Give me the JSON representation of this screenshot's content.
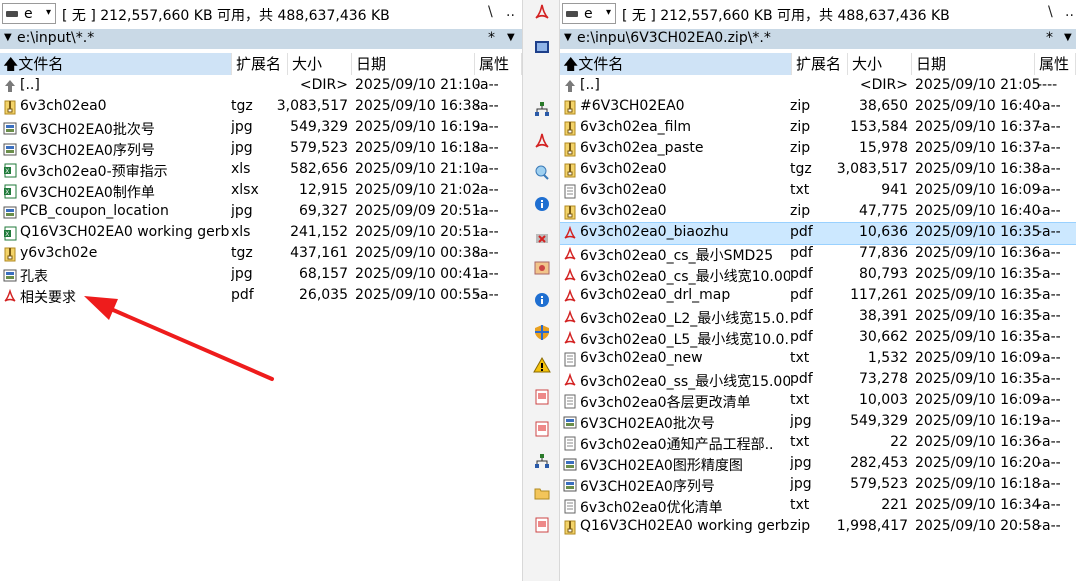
{
  "left": {
    "drive": {
      "letter": "e",
      "info": "[ 无 ]  212,557,660 KB 可用，共 488,637,436 KB",
      "root_btn": "\\",
      "up_btn": ".."
    },
    "path": "e:\\input\\*.*",
    "filter_star": "*",
    "headers": {
      "name": "文件名",
      "ext": "扩展名",
      "size": "大小",
      "date": "日期",
      "attr": "属性"
    },
    "rows": [
      {
        "name": "[..]",
        "ext": "",
        "size": "<DIR>",
        "date": "2025/09/10 21:10",
        "attr": "-a--",
        "icon": "up"
      },
      {
        "name": "6v3ch02ea0",
        "ext": "tgz",
        "size": "3,083,517",
        "date": "2025/09/10 16:38",
        "attr": "-a--",
        "icon": "zip"
      },
      {
        "name": "6V3CH02EA0批次号",
        "ext": "jpg",
        "size": "549,329",
        "date": "2025/09/10 16:19",
        "attr": "-a--",
        "icon": "img"
      },
      {
        "name": "6V3CH02EA0序列号",
        "ext": "jpg",
        "size": "579,523",
        "date": "2025/09/10 16:18",
        "attr": "-a--",
        "icon": "img"
      },
      {
        "name": "6v3ch02ea0-预审指示",
        "ext": "xls",
        "size": "582,656",
        "date": "2025/09/10 21:10",
        "attr": "-a--",
        "icon": "xls"
      },
      {
        "name": "6V3CH02EA0制作单",
        "ext": "xlsx",
        "size": "12,915",
        "date": "2025/09/10 21:02",
        "attr": "-a--",
        "icon": "xls"
      },
      {
        "name": "PCB_coupon_location",
        "ext": "jpg",
        "size": "69,327",
        "date": "2025/09/09 20:51",
        "attr": "-a--",
        "icon": "img"
      },
      {
        "name": "Q16V3CH02EA0 working gerb..",
        "ext": "xls",
        "size": "241,152",
        "date": "2025/09/10 20:51",
        "attr": "-a--",
        "icon": "xls"
      },
      {
        "name": "y6v3ch02e",
        "ext": "tgz",
        "size": "437,161",
        "date": "2025/09/10 00:38",
        "attr": "-a--",
        "icon": "zip"
      },
      {
        "name": "孔表",
        "ext": "jpg",
        "size": "68,157",
        "date": "2025/09/10 00:41",
        "attr": "-a--",
        "icon": "img"
      },
      {
        "name": "相关要求",
        "ext": "pdf",
        "size": "26,035",
        "date": "2025/09/10 00:55",
        "attr": "-a--",
        "icon": "pdf"
      }
    ]
  },
  "right": {
    "drive": {
      "letter": "e",
      "info": "[ 无 ]  212,557,660 KB 可用，共 488,637,436 KB",
      "root_btn": "\\",
      "up_btn": ".."
    },
    "path": "e:\\inpu\\6V3CH02EA0.zip\\*.*",
    "filter_star": "*",
    "headers": {
      "name": "文件名",
      "ext": "扩展名",
      "size": "大小",
      "date": "日期",
      "attr": "属性"
    },
    "rows": [
      {
        "name": "[..]",
        "ext": "",
        "size": "<DIR>",
        "date": "2025/09/10 21:05",
        "attr": "----",
        "icon": "up"
      },
      {
        "name": "#6V3CH02EA0",
        "ext": "zip",
        "size": "38,650",
        "date": "2025/09/10 16:40",
        "attr": "-a--",
        "icon": "zip"
      },
      {
        "name": "6v3ch02ea_film",
        "ext": "zip",
        "size": "153,584",
        "date": "2025/09/10 16:37",
        "attr": "-a--",
        "icon": "zip"
      },
      {
        "name": "6v3ch02ea_paste",
        "ext": "zip",
        "size": "15,978",
        "date": "2025/09/10 16:37",
        "attr": "-a--",
        "icon": "zip"
      },
      {
        "name": "6v3ch02ea0",
        "ext": "tgz",
        "size": "3,083,517",
        "date": "2025/09/10 16:38",
        "attr": "-a--",
        "icon": "zip"
      },
      {
        "name": "6v3ch02ea0",
        "ext": "txt",
        "size": "941",
        "date": "2025/09/10 16:09",
        "attr": "-a--",
        "icon": "txt"
      },
      {
        "name": "6v3ch02ea0",
        "ext": "zip",
        "size": "47,775",
        "date": "2025/09/10 16:40",
        "attr": "-a--",
        "icon": "zip"
      },
      {
        "name": "6v3ch02ea0_biaozhu",
        "ext": "pdf",
        "size": "10,636",
        "date": "2025/09/10 16:35",
        "attr": "-a--",
        "icon": "pdf"
      },
      {
        "name": "6v3ch02ea0_cs_最小SMD25",
        "ext": "pdf",
        "size": "77,836",
        "date": "2025/09/10 16:36",
        "attr": "-a--",
        "icon": "pdf"
      },
      {
        "name": "6v3ch02ea0_cs_最小线宽10.00..",
        "ext": "pdf",
        "size": "80,793",
        "date": "2025/09/10 16:35",
        "attr": "-a--",
        "icon": "pdf"
      },
      {
        "name": "6v3ch02ea0_drl_map",
        "ext": "pdf",
        "size": "117,261",
        "date": "2025/09/10 16:35",
        "attr": "-a--",
        "icon": "pdf"
      },
      {
        "name": "6v3ch02ea0_L2_最小线宽15.0..",
        "ext": "pdf",
        "size": "38,391",
        "date": "2025/09/10 16:35",
        "attr": "-a--",
        "icon": "pdf"
      },
      {
        "name": "6v3ch02ea0_L5_最小线宽10.0..",
        "ext": "pdf",
        "size": "30,662",
        "date": "2025/09/10 16:35",
        "attr": "-a--",
        "icon": "pdf"
      },
      {
        "name": "6v3ch02ea0_new",
        "ext": "txt",
        "size": "1,532",
        "date": "2025/09/10 16:09",
        "attr": "-a--",
        "icon": "txt"
      },
      {
        "name": "6v3ch02ea0_ss_最小线宽15.000",
        "ext": "pdf",
        "size": "73,278",
        "date": "2025/09/10 16:35",
        "attr": "-a--",
        "icon": "pdf"
      },
      {
        "name": "6v3ch02ea0各层更改清单",
        "ext": "txt",
        "size": "10,003",
        "date": "2025/09/10 16:09",
        "attr": "-a--",
        "icon": "txt"
      },
      {
        "name": "6V3CH02EA0批次号",
        "ext": "jpg",
        "size": "549,329",
        "date": "2025/09/10 16:19",
        "attr": "-a--",
        "icon": "img"
      },
      {
        "name": "6v3ch02ea0通知产品工程部..",
        "ext": "txt",
        "size": "22",
        "date": "2025/09/10 16:36",
        "attr": "-a--",
        "icon": "txt"
      },
      {
        "name": "6V3CH02EA0图形精度图",
        "ext": "jpg",
        "size": "282,453",
        "date": "2025/09/10 16:20",
        "attr": "-a--",
        "icon": "img"
      },
      {
        "name": "6V3CH02EA0序列号",
        "ext": "jpg",
        "size": "579,523",
        "date": "2025/09/10 16:18",
        "attr": "-a--",
        "icon": "img"
      },
      {
        "name": "6v3ch02ea0优化清单",
        "ext": "txt",
        "size": "221",
        "date": "2025/09/10 16:34",
        "attr": "-a--",
        "icon": "txt"
      },
      {
        "name": "Q16V3CH02EA0 working gerb..",
        "ext": "zip",
        "size": "1,998,417",
        "date": "2025/09/10 20:58",
        "attr": "-a--",
        "icon": "zip"
      }
    ],
    "selected_row": 7
  },
  "toolbar": {
    "buttons": [
      "pdf-icon",
      "terminal-icon",
      "network-icon",
      "pdf-icon",
      "search-icon",
      "info-icon",
      "delete-icon",
      "image-icon",
      "info-icon",
      "shield-icon",
      "warning-icon",
      "document-icon",
      "document-icon",
      "network-icon",
      "folder-icon",
      "document-icon"
    ]
  },
  "colors": {
    "path_bar": "#c9d9e6",
    "sorted_header": "#cfe3f6",
    "selection": "#cce8ff",
    "annotation_arrow": "#ee1c1c",
    "pdf_red": "#d32222",
    "zip_yellow": "#e8c040",
    "excel_green": "#1f7a3a"
  }
}
